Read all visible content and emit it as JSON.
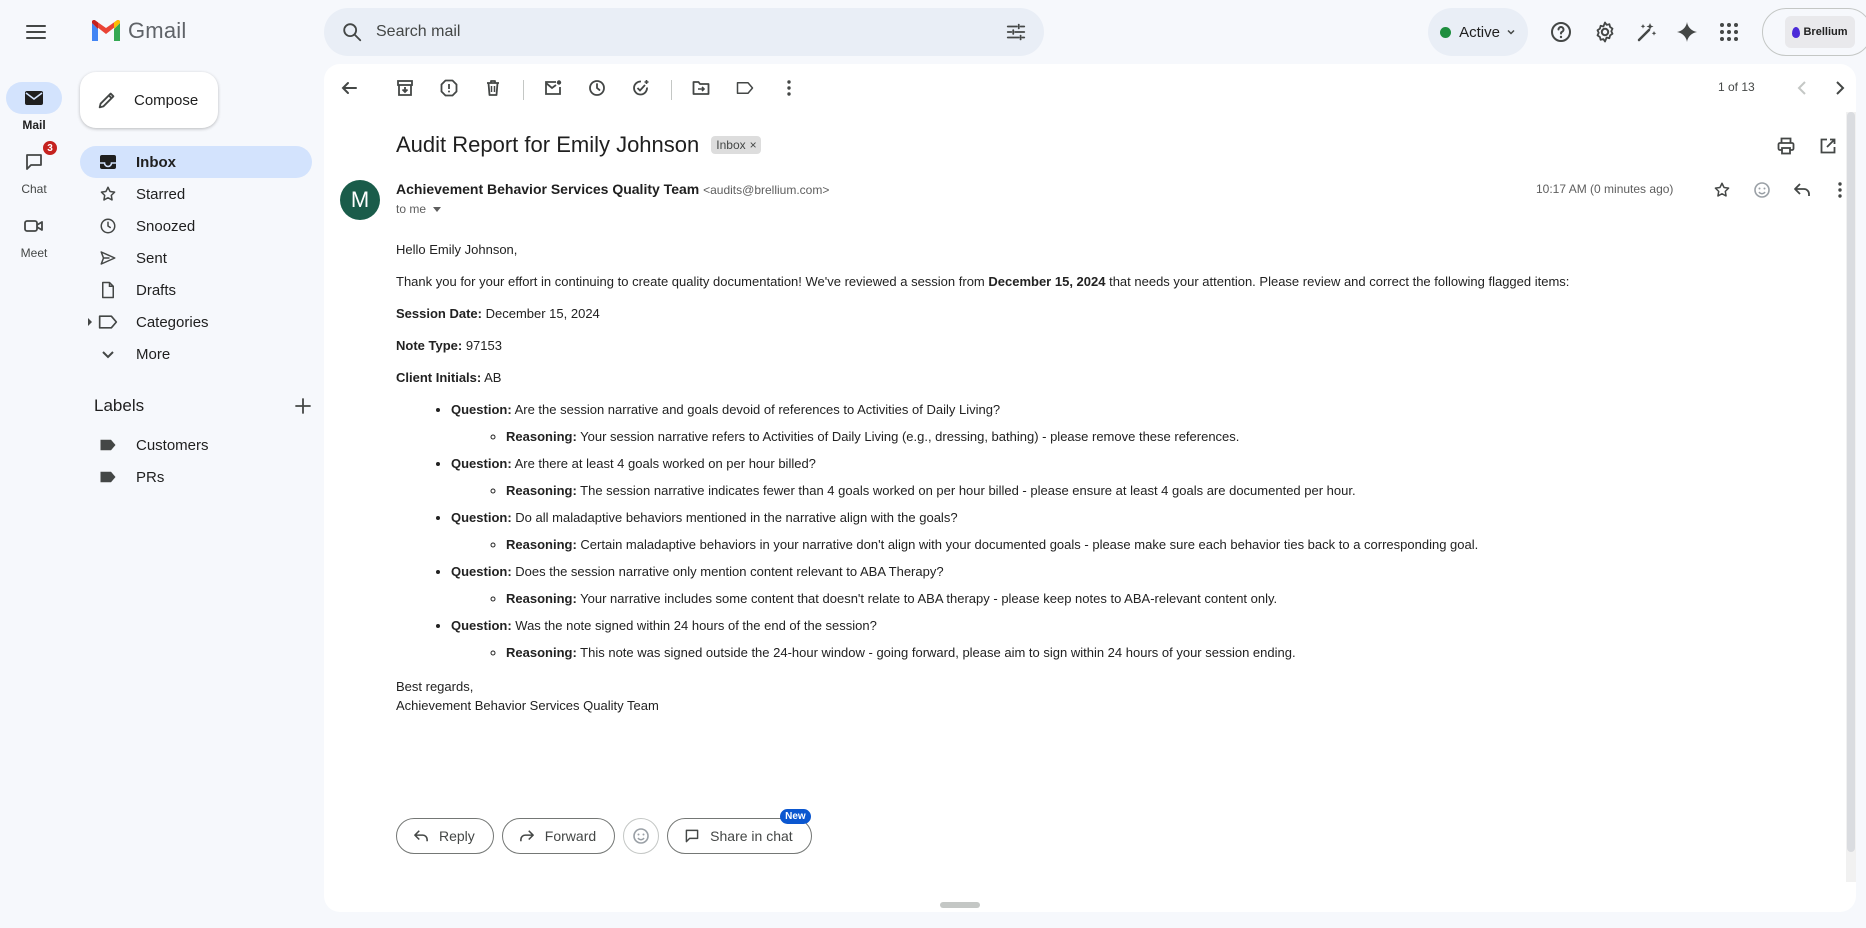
{
  "app": {
    "name": "Gmail"
  },
  "search": {
    "placeholder": "Search mail"
  },
  "status": {
    "label": "Active",
    "color": "#1e8e3e"
  },
  "account": {
    "brand": "Brellium"
  },
  "rail": [
    {
      "label": "Mail",
      "icon": "mail-icon",
      "badge": ""
    },
    {
      "label": "Chat",
      "icon": "chat-icon",
      "badge": "3"
    },
    {
      "label": "Meet",
      "icon": "video-icon",
      "badge": ""
    }
  ],
  "compose": {
    "label": "Compose"
  },
  "nav": [
    {
      "label": "Inbox",
      "icon": "inbox-icon"
    },
    {
      "label": "Starred",
      "icon": "star-icon"
    },
    {
      "label": "Snoozed",
      "icon": "clock-icon"
    },
    {
      "label": "Sent",
      "icon": "send-icon"
    },
    {
      "label": "Drafts",
      "icon": "draft-icon"
    },
    {
      "label": "Categories",
      "icon": "label-icon"
    },
    {
      "label": "More",
      "icon": "chevron-down-icon"
    }
  ],
  "labels": {
    "title": "Labels",
    "items": [
      {
        "label": "Customers"
      },
      {
        "label": "PRs"
      }
    ]
  },
  "toolbar": {
    "pager": "1 of 13"
  },
  "email": {
    "subject": "Audit Report for Emily Johnson",
    "chip": "Inbox",
    "chip_close": "×",
    "avatar_letter": "M",
    "sender_name": "Achievement Behavior Services Quality Team",
    "sender_email": "<audits@brellium.com>",
    "to": "to me",
    "time": "10:17 AM (0 minutes ago)",
    "greeting": "Hello Emily Johnson,",
    "intro_before": "Thank you for your effort in continuing to create quality documentation! We've reviewed a session from ",
    "intro_date": "December 15, 2024",
    "intro_after": " that needs your attention. Please review and correct the following flagged items:",
    "fields": [
      {
        "label": "Session Date:",
        "value": " December 15, 2024"
      },
      {
        "label": "Note Type:",
        "value": " 97153"
      },
      {
        "label": "Client Initials:",
        "value": " AB"
      }
    ],
    "question_label": "Question:",
    "reasoning_label": "Reasoning:",
    "items": [
      {
        "question": " Are the session narrative and goals devoid of references to Activities of Daily Living?",
        "reasoning": " Your session narrative refers to Activities of Daily Living (e.g., dressing, bathing) - please remove these references."
      },
      {
        "question": " Are there at least 4 goals worked on per hour billed?",
        "reasoning": " The session narrative indicates fewer than 4 goals worked on per hour billed - please ensure at least 4 goals are documented per hour."
      },
      {
        "question": " Do all maladaptive behaviors mentioned in the narrative align with the goals?",
        "reasoning": " Certain maladaptive behaviors in your narrative don't align with your documented goals - please make sure each behavior ties back to a corresponding goal."
      },
      {
        "question": " Does the session narrative only mention content relevant to ABA Therapy?",
        "reasoning": " Your narrative includes some content that doesn't relate to ABA therapy - please keep notes to ABA-relevant content only."
      },
      {
        "question": " Was the note signed within 24 hours of the end of the session?",
        "reasoning": " This note was signed outside the 24-hour window - going forward, please aim to sign within 24 hours of your session ending."
      }
    ],
    "signoff_1": "Best regards,",
    "signoff_2": "Achievement Behavior Services Quality Team"
  },
  "actions": {
    "reply": "Reply",
    "forward": "Forward",
    "share": "Share in chat",
    "new_badge": "New"
  }
}
